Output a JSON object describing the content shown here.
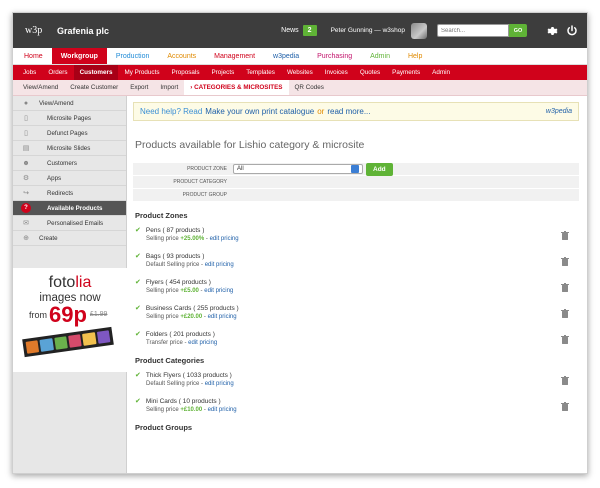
{
  "colors": {
    "brand_red": "#d0021b",
    "green": "#5fb336",
    "dark": "#3d3d3d",
    "link": "#1e5fa8"
  },
  "topbar": {
    "logo": "w3p",
    "company": "Grafenia plc",
    "news_label": "News",
    "news_count": "2",
    "user": "Peter Gunning — w3shop",
    "search_placeholder": "Search...",
    "search_go": "GO"
  },
  "main_nav": [
    {
      "label": "Home",
      "color": "#d0021b"
    },
    {
      "label": "Workgroup",
      "color": "#ffffff"
    },
    {
      "label": "Production",
      "color": "#1e8ad6"
    },
    {
      "label": "Accounts",
      "color": "#e08a00"
    },
    {
      "label": "Management",
      "color": "#d0021b"
    },
    {
      "label": "w3pedia",
      "color": "#1e5fa8"
    },
    {
      "label": "Purchasing",
      "color": "#c2126b"
    },
    {
      "label": "Admin",
      "color": "#5fb336"
    },
    {
      "label": "Help",
      "color": "#e08a00"
    }
  ],
  "sub_nav": [
    "Jobs",
    "Orders",
    "Customers",
    "My Products",
    "Proposals",
    "Projects",
    "Templates",
    "Websites",
    "Invoices",
    "Quotes",
    "Payments",
    "Admin"
  ],
  "tert_nav": [
    "View/Amend",
    "Create Customer",
    "Export",
    "Import",
    "› CATEGORIES & MICROSITES",
    "QR Codes"
  ],
  "sidebar": [
    {
      "label": "View/Amend",
      "icon": "circle-icon"
    },
    {
      "label": "Microsite Pages",
      "icon": "page-icon"
    },
    {
      "label": "Defunct Pages",
      "icon": "page-icon"
    },
    {
      "label": "Microsite Slides",
      "icon": "slides-icon"
    },
    {
      "label": "Customers",
      "icon": "customers-icon"
    },
    {
      "label": "Apps",
      "icon": "apps-icon"
    },
    {
      "label": "Redirects",
      "icon": "redirect-icon"
    },
    {
      "label": "Available Products",
      "icon": "question-icon"
    },
    {
      "label": "Personalised Emails",
      "icon": "email-icon"
    },
    {
      "label": "Create",
      "icon": "plus-icon"
    }
  ],
  "ad": {
    "brand_a": "foto",
    "brand_b": "lia",
    "line2": "images now",
    "from": "from",
    "price": "69p",
    "old_price": "£1.99"
  },
  "help": {
    "question": "Need help? Read",
    "link1": "Make your own print catalogue",
    "or": "or",
    "link2": "read more...",
    "w3pedia": "w3pedia"
  },
  "page_title": "Products available for Lishio category & microsite",
  "filter": {
    "zone_label": "PRODUCT ZONE",
    "zone_value": "All",
    "add_label": "Add",
    "category_label": "PRODUCT CATEGORY",
    "group_label": "PRODUCT GROUP"
  },
  "zones_heading": "Product Zones",
  "zones": [
    {
      "name": "Pens ( 87 products )",
      "price_label": "Selling price",
      "modifier": "+25.00%",
      "edit": "edit pricing"
    },
    {
      "name": "Bags ( 93 products )",
      "price_label": "Default Selling price",
      "modifier": "",
      "edit": "edit pricing"
    },
    {
      "name": "Flyers ( 454 products )",
      "price_label": "Selling price",
      "modifier": "+£5.00",
      "edit": "edit pricing"
    },
    {
      "name": "Business Cards ( 255 products )",
      "price_label": "Selling price",
      "modifier": "+£20.00",
      "edit": "edit pricing"
    },
    {
      "name": "Folders ( 201 products )",
      "price_label": "Transfer price",
      "modifier": "",
      "edit": "edit pricing"
    }
  ],
  "categories_heading": "Product Categories",
  "categories": [
    {
      "name": "Thick Flyers ( 1033 products )",
      "price_label": "Default Selling price",
      "modifier": "",
      "edit": "edit pricing"
    },
    {
      "name": "Mini Cards ( 10 products )",
      "price_label": "Selling price",
      "modifier": "+£10.00",
      "edit": "edit pricing"
    }
  ],
  "groups_heading": "Product Groups"
}
